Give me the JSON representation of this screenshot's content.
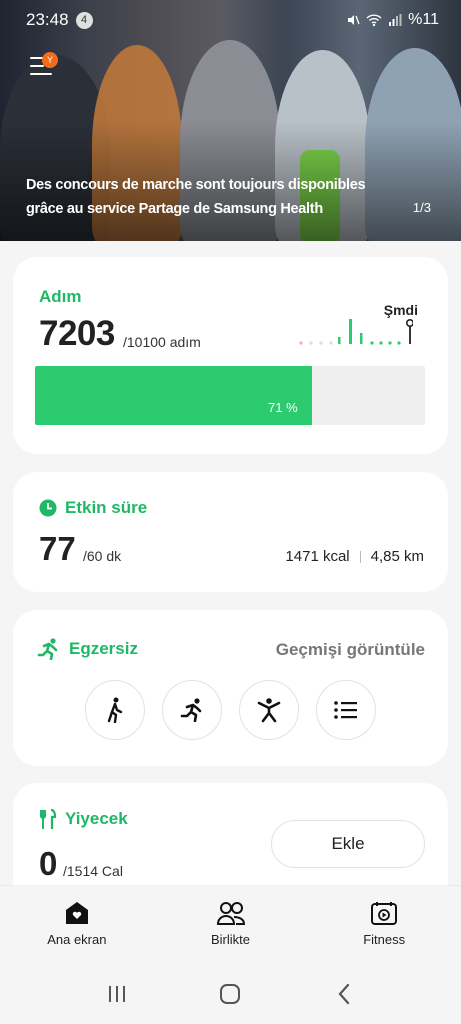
{
  "status_bar": {
    "time": "23:48",
    "notification_count": "4",
    "battery": "%11",
    "icons": [
      "mute-icon",
      "wifi-icon",
      "signal-icon"
    ]
  },
  "hero": {
    "menu_badge": "Y",
    "caption": "Des concours de marche sont toujours disponibles grâce au service Partage de Samsung Health",
    "page_indicator": "1/3"
  },
  "steps": {
    "title": "Adım",
    "value": "7203",
    "goal": "/10100 adım",
    "now_label": "Şmdi",
    "progress_fraction": 0.71,
    "progress_label": "71 %"
  },
  "active_time": {
    "title": "Etkin süre",
    "value": "77",
    "goal": "/60 dk",
    "calories": "1471 kcal",
    "distance": "4,85 km"
  },
  "exercise": {
    "title": "Egzersiz",
    "history_link": "Geçmişi görüntüle",
    "buttons": [
      "walking-icon",
      "running-icon",
      "workout-icon",
      "list-icon"
    ]
  },
  "food": {
    "title": "Yiyecek",
    "value": "0",
    "goal": "/1514 Cal",
    "add_label": "Ekle"
  },
  "bottom_nav": {
    "items": [
      {
        "label": "Ana ekran",
        "icon": "home-icon"
      },
      {
        "label": "Birlikte",
        "icon": "together-icon"
      },
      {
        "label": "Fitness",
        "icon": "fitness-icon"
      }
    ]
  },
  "colors": {
    "accent_green": "#1fb866",
    "progress_green": "#2ccb6f",
    "badge_orange": "#f36b1c"
  }
}
